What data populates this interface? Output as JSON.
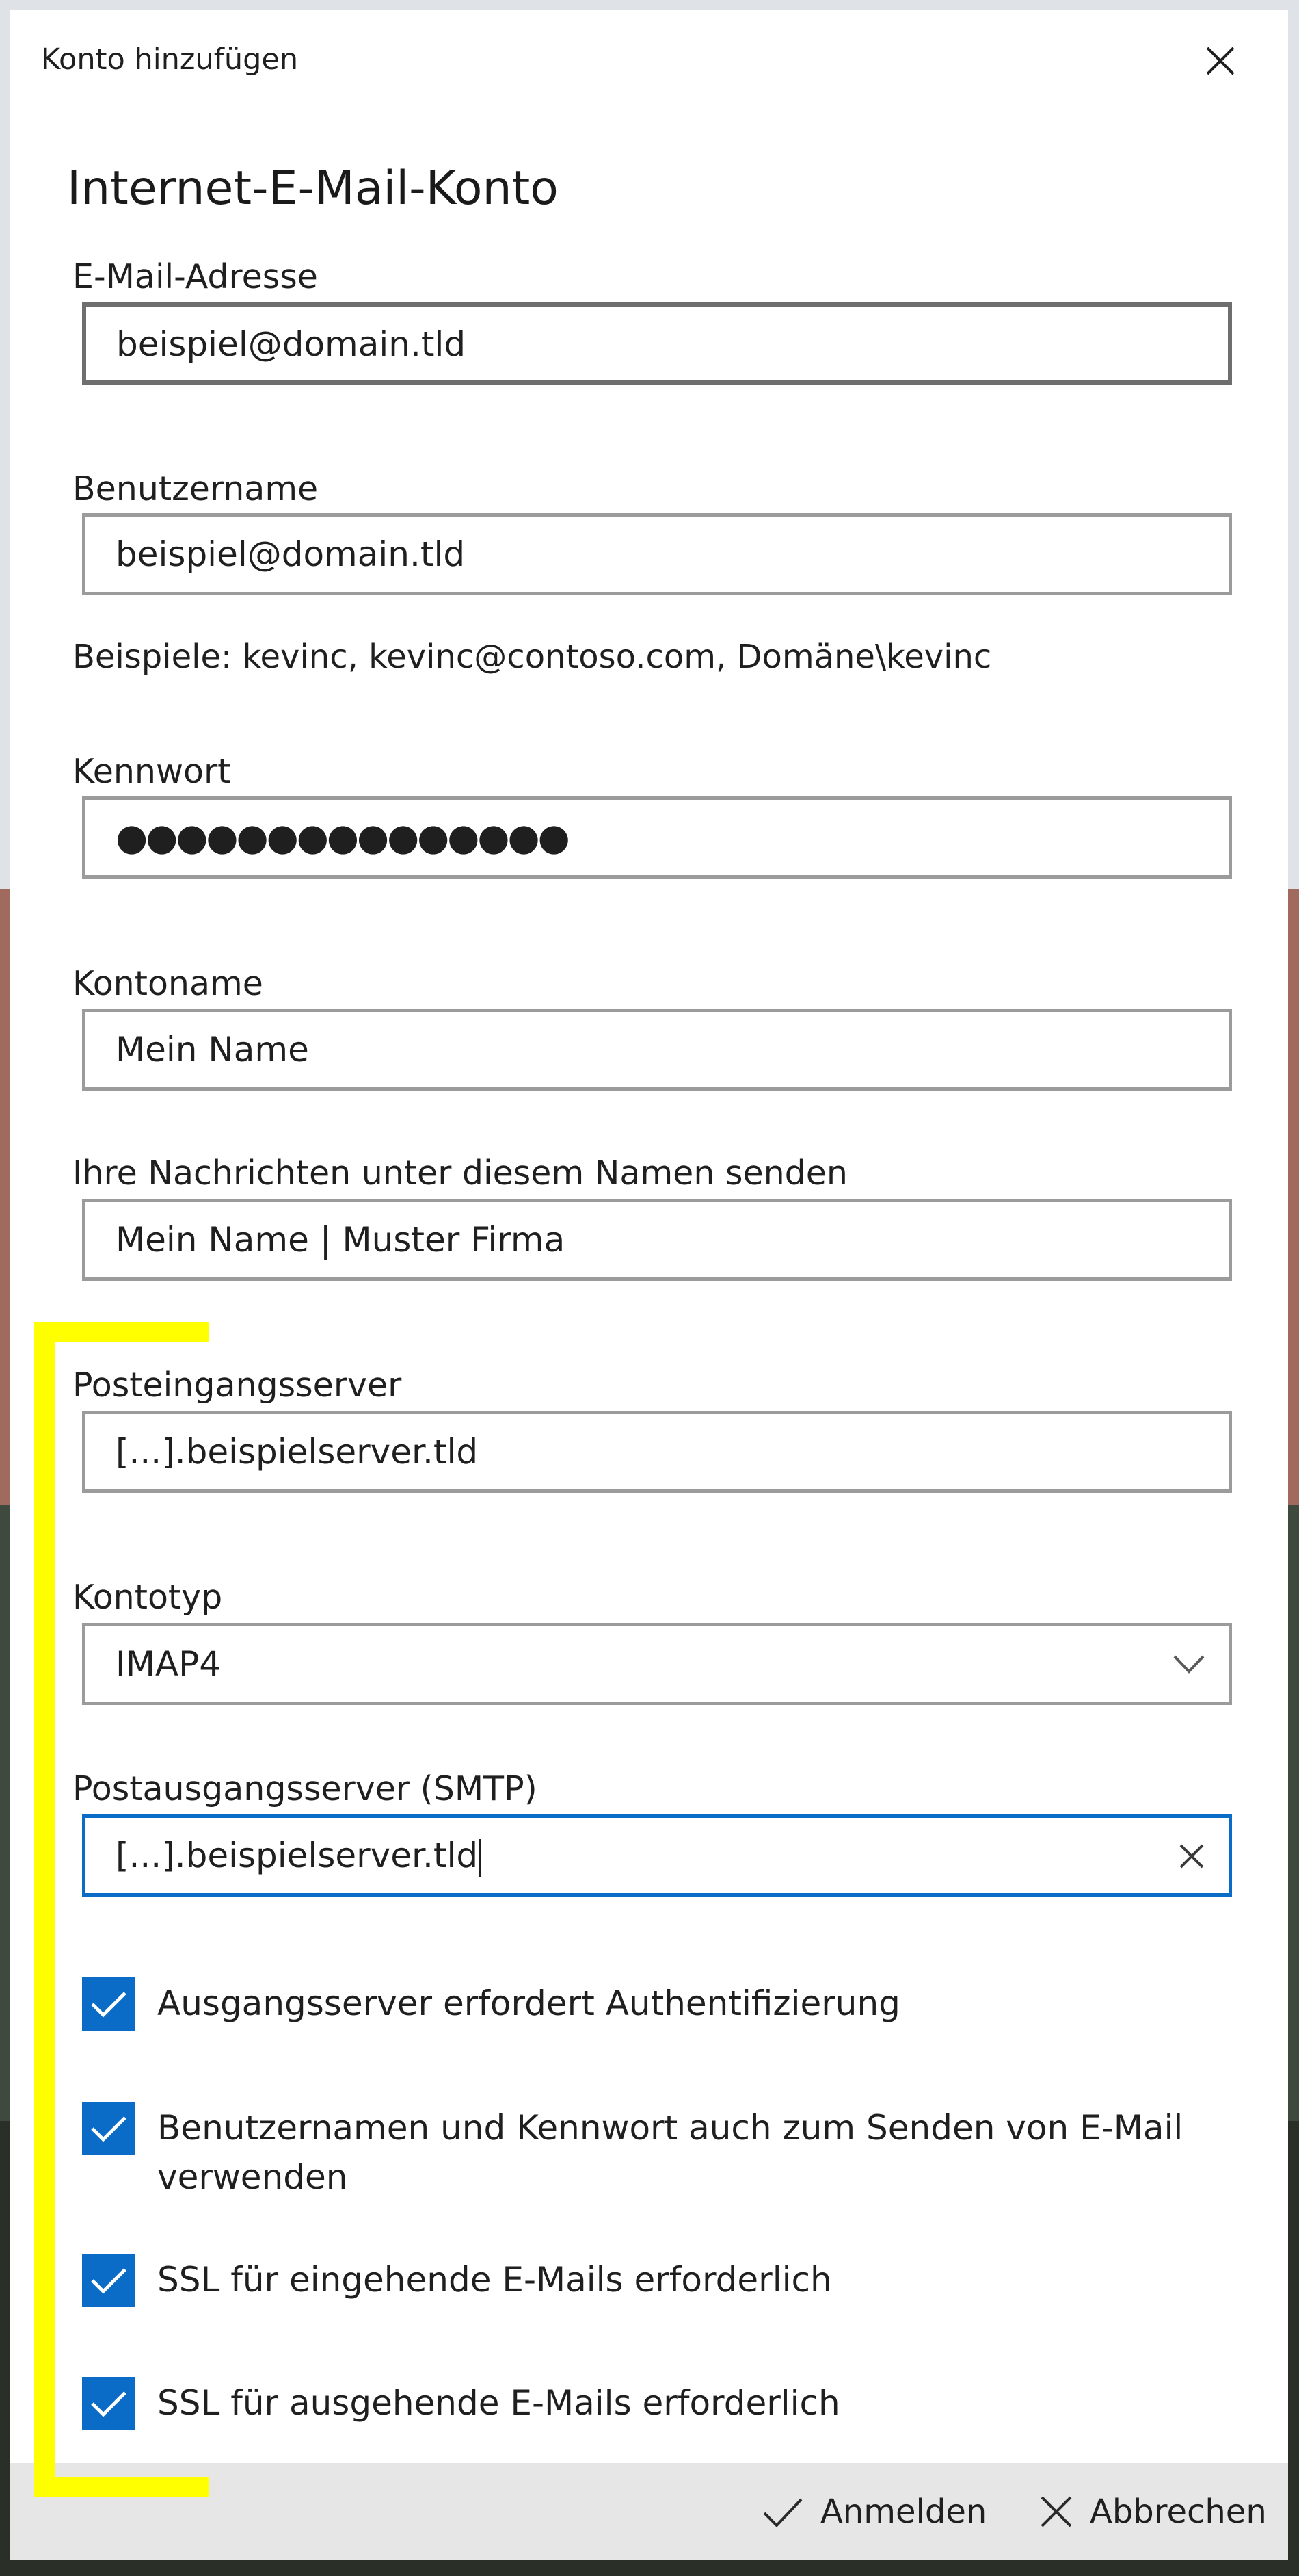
{
  "window": {
    "title": "Konto hinzufügen"
  },
  "heading": "Internet-E-Mail-Konto",
  "fields": {
    "email": {
      "label": "E-Mail-Adresse",
      "value": "beispiel@domain.tld"
    },
    "username": {
      "label": "Benutzername",
      "value": "beispiel@domain.tld",
      "hint": "Beispiele: kevinc, kevinc@contoso.com, Domäne\\kevinc"
    },
    "password": {
      "label": "Kennwort",
      "value": "●●●●●●●●●●●●●●●"
    },
    "account_name": {
      "label": "Kontoname",
      "value": "Mein Name"
    },
    "send_name": {
      "label": "Ihre Nachrichten unter diesem Namen senden",
      "value": "Mein Name | Muster Firma"
    },
    "incoming_server": {
      "label": "Posteingangsserver",
      "value": "[...].beispielserver.tld"
    },
    "account_type": {
      "label": "Kontotyp",
      "value": "IMAP4"
    },
    "outgoing_server": {
      "label": "Postausgangsserver (SMTP)",
      "value": "[...].beispielserver.tld"
    }
  },
  "checkboxes": [
    {
      "label": "Ausgangsserver erfordert Authentifizierung",
      "checked": true
    },
    {
      "label": "Benutzernamen und Kennwort auch zum Senden von E-Mail verwenden",
      "checked": true
    },
    {
      "label": "SSL für eingehende E-Mails erforderlich",
      "checked": true
    },
    {
      "label": "SSL für ausgehende E-Mails erforderlich",
      "checked": true
    }
  ],
  "footer": {
    "sign_in": "Anmelden",
    "cancel": "Abbrechen"
  },
  "colors": {
    "accent": "#0a6cc7",
    "highlight": "#ffff00",
    "footer_bg": "#e6e6e6"
  },
  "icons": {
    "close": "close-icon",
    "dropdown": "chevron-down-icon",
    "clear": "clear-icon",
    "check": "checkmark-icon",
    "cancel": "cancel-icon"
  }
}
